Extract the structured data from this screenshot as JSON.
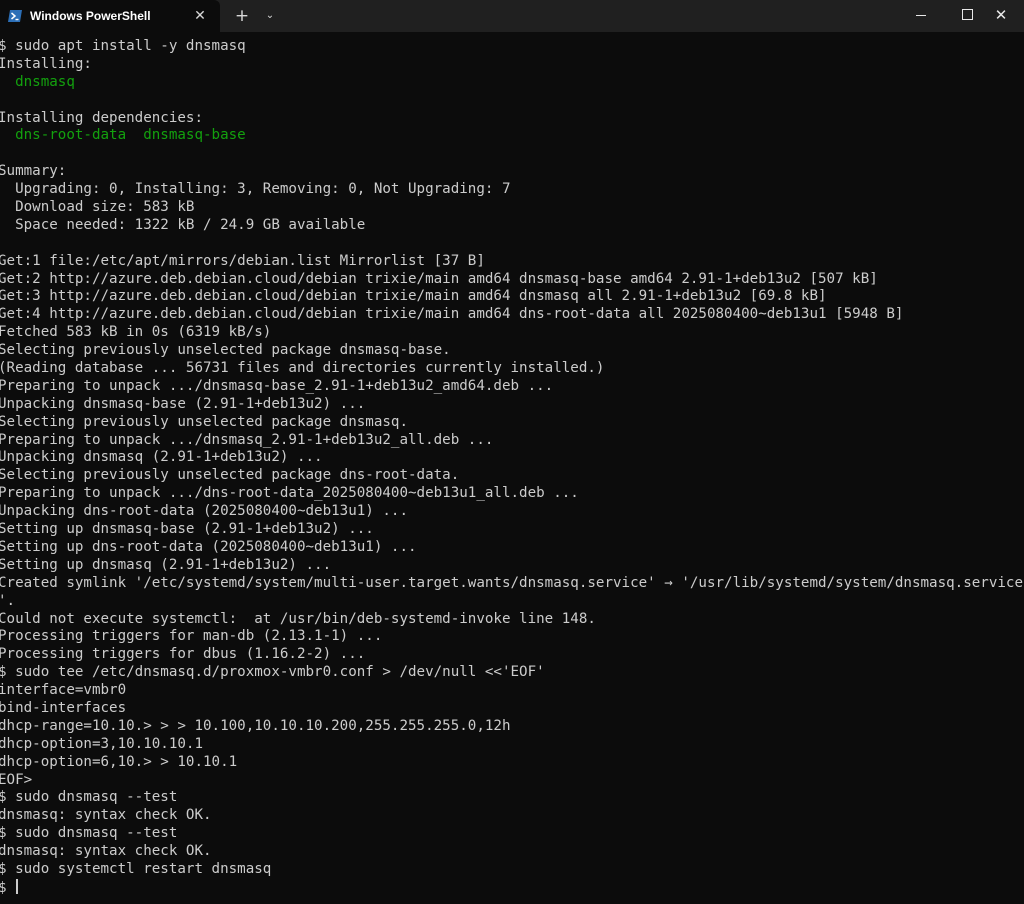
{
  "window": {
    "tab_title": "Windows PowerShell",
    "tab_icon": "powershell-icon",
    "close_tab_symbol": "✕",
    "new_tab_symbol": "+",
    "dropdown_symbol": "⌄",
    "close_window_symbol": "✕"
  },
  "colors": {
    "background": "#0c0c0c",
    "titlebar": "#202020",
    "text": "#cccccc",
    "green": "#13a10e"
  },
  "terminal": {
    "lines": [
      {
        "text": "$ sudo apt install -y dnsmasq",
        "color": "default"
      },
      {
        "text": "Installing:",
        "color": "default"
      },
      {
        "text": "  dnsmasq",
        "color": "green"
      },
      {
        "text": "",
        "color": "default"
      },
      {
        "text": "Installing dependencies:",
        "color": "default"
      },
      {
        "text": "  dns-root-data  dnsmasq-base",
        "color": "green"
      },
      {
        "text": "",
        "color": "default"
      },
      {
        "text": "Summary:",
        "color": "default"
      },
      {
        "text": "  Upgrading: 0, Installing: 3, Removing: 0, Not Upgrading: 7",
        "color": "default"
      },
      {
        "text": "  Download size: 583 kB",
        "color": "default"
      },
      {
        "text": "  Space needed: 1322 kB / 24.9 GB available",
        "color": "default"
      },
      {
        "text": "",
        "color": "default"
      },
      {
        "text": "Get:1 file:/etc/apt/mirrors/debian.list Mirrorlist [37 B]",
        "color": "default"
      },
      {
        "text": "Get:2 http://azure.deb.debian.cloud/debian trixie/main amd64 dnsmasq-base amd64 2.91-1+deb13u2 [507 kB]",
        "color": "default"
      },
      {
        "text": "Get:3 http://azure.deb.debian.cloud/debian trixie/main amd64 dnsmasq all 2.91-1+deb13u2 [69.8 kB]",
        "color": "default"
      },
      {
        "text": "Get:4 http://azure.deb.debian.cloud/debian trixie/main amd64 dns-root-data all 2025080400~deb13u1 [5948 B]",
        "color": "default"
      },
      {
        "text": "Fetched 583 kB in 0s (6319 kB/s)",
        "color": "default"
      },
      {
        "text": "Selecting previously unselected package dnsmasq-base.",
        "color": "default"
      },
      {
        "text": "(Reading database ... 56731 files and directories currently installed.)",
        "color": "default"
      },
      {
        "text": "Preparing to unpack .../dnsmasq-base_2.91-1+deb13u2_amd64.deb ...",
        "color": "default"
      },
      {
        "text": "Unpacking dnsmasq-base (2.91-1+deb13u2) ...",
        "color": "default"
      },
      {
        "text": "Selecting previously unselected package dnsmasq.",
        "color": "default"
      },
      {
        "text": "Preparing to unpack .../dnsmasq_2.91-1+deb13u2_all.deb ...",
        "color": "default"
      },
      {
        "text": "Unpacking dnsmasq (2.91-1+deb13u2) ...",
        "color": "default"
      },
      {
        "text": "Selecting previously unselected package dns-root-data.",
        "color": "default"
      },
      {
        "text": "Preparing to unpack .../dns-root-data_2025080400~deb13u1_all.deb ...",
        "color": "default"
      },
      {
        "text": "Unpacking dns-root-data (2025080400~deb13u1) ...",
        "color": "default"
      },
      {
        "text": "Setting up dnsmasq-base (2.91-1+deb13u2) ...",
        "color": "default"
      },
      {
        "text": "Setting up dns-root-data (2025080400~deb13u1) ...",
        "color": "default"
      },
      {
        "text": "Setting up dnsmasq (2.91-1+deb13u2) ...",
        "color": "default"
      },
      {
        "text": "Created symlink '/etc/systemd/system/multi-user.target.wants/dnsmasq.service' → '/usr/lib/systemd/system/dnsmasq.service",
        "color": "default"
      },
      {
        "text": "'.",
        "color": "default"
      },
      {
        "text": "Could not execute systemctl:  at /usr/bin/deb-systemd-invoke line 148.",
        "color": "default"
      },
      {
        "text": "Processing triggers for man-db (2.13.1-1) ...",
        "color": "default"
      },
      {
        "text": "Processing triggers for dbus (1.16.2-2) ...",
        "color": "default"
      },
      {
        "text": "$ sudo tee /etc/dnsmasq.d/proxmox-vmbr0.conf > /dev/null <<'EOF'",
        "color": "default"
      },
      {
        "text": "interface=vmbr0",
        "color": "default"
      },
      {
        "text": "bind-interfaces",
        "color": "default"
      },
      {
        "text": "dhcp-range=10.10.> > > 10.100,10.10.10.200,255.255.255.0,12h",
        "color": "default"
      },
      {
        "text": "dhcp-option=3,10.10.10.1",
        "color": "default"
      },
      {
        "text": "dhcp-option=6,10.> > 10.10.1",
        "color": "default"
      },
      {
        "text": "EOF>",
        "color": "default"
      },
      {
        "text": "$ sudo dnsmasq --test",
        "color": "default"
      },
      {
        "text": "dnsmasq: syntax check OK.",
        "color": "default"
      },
      {
        "text": "$ sudo dnsmasq --test",
        "color": "default"
      },
      {
        "text": "dnsmasq: syntax check OK.",
        "color": "default"
      },
      {
        "text": "$ sudo systemctl restart dnsmasq",
        "color": "default"
      },
      {
        "text": "$ ",
        "color": "default",
        "cursor": true
      }
    ]
  }
}
